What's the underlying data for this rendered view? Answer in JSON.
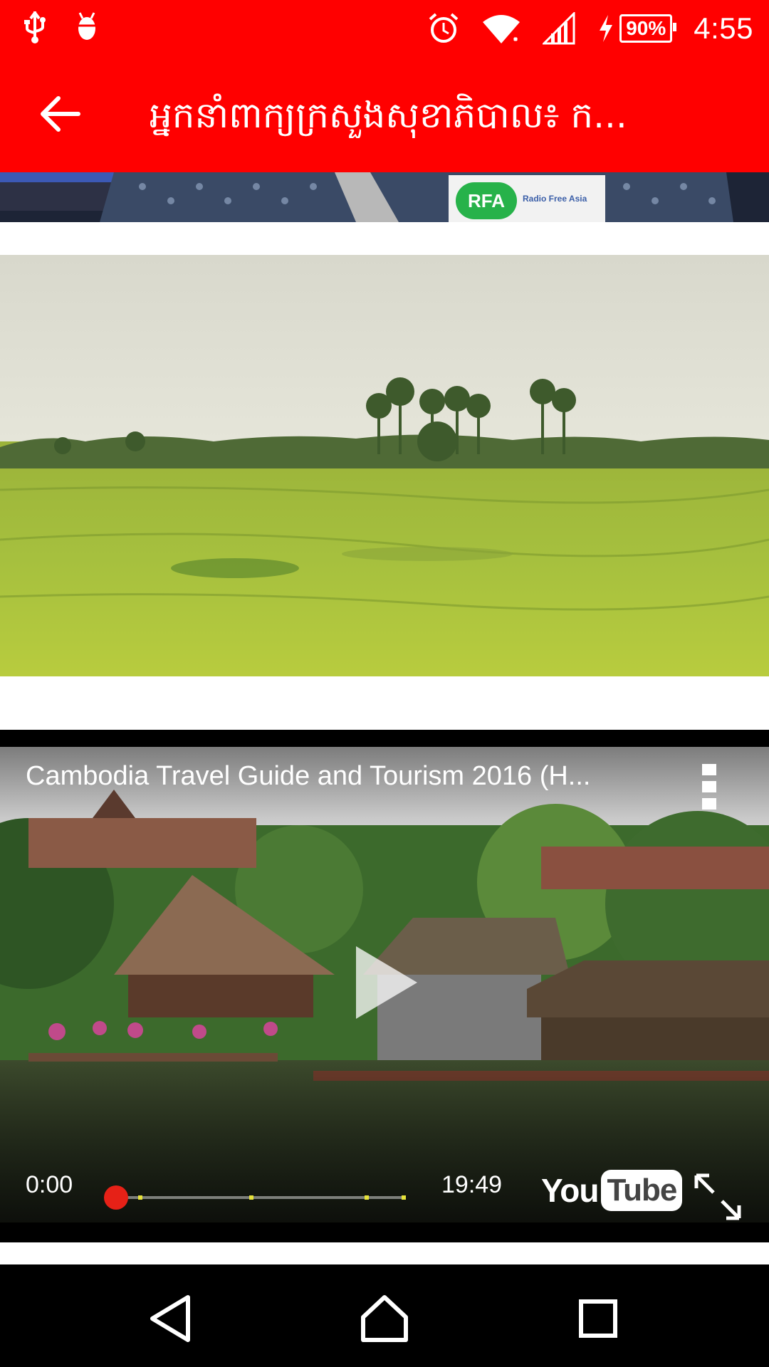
{
  "status_bar": {
    "battery_percent": "90%",
    "time": "4:55",
    "icons": [
      "usb-icon",
      "android-debug-icon",
      "alarm-icon",
      "wifi-icon",
      "cell-signal-icon",
      "charging-icon",
      "battery-icon"
    ]
  },
  "app_bar": {
    "title": "អ្នកនាំពាក្យក្រសួងសុខាភិបាល៖ ក...",
    "back_icon": "arrow-back-icon",
    "color": "#ff0000"
  },
  "images": {
    "top_partial": {
      "badge": "RFA",
      "badge_sub": "Radio Free Asia"
    }
  },
  "video": {
    "title": "Cambodia Travel Guide and Tourism 2016 (H...",
    "current_time": "0:00",
    "duration": "19:49",
    "progress": 0,
    "logo": {
      "you": "You",
      "tube": "Tube"
    },
    "knob_color": "#e62117"
  },
  "nav_bar": {
    "buttons": [
      "back",
      "home",
      "recents"
    ]
  }
}
